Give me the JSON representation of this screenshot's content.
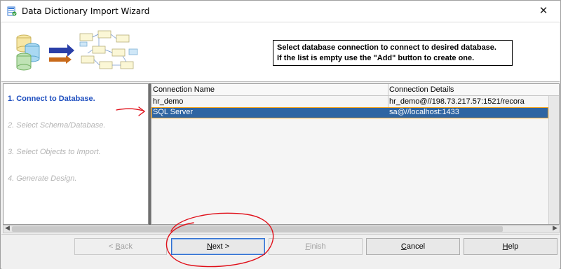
{
  "window": {
    "title": "Data Dictionary Import Wizard",
    "close_label": "✕"
  },
  "header": {
    "instruction_line1": "Select database connection to connect to desired database.",
    "instruction_line2": "If the list is empty use the \"Add\" button to create one."
  },
  "steps": [
    {
      "label": "1. Connect to Database.",
      "state": "active"
    },
    {
      "label": "2. Select Schema/Database.",
      "state": "inactive"
    },
    {
      "label": "3. Select Objects to Import.",
      "state": "inactive"
    },
    {
      "label": "4. Generate Design.",
      "state": "inactive"
    }
  ],
  "table": {
    "columns": [
      "Connection Name",
      "Connection Details"
    ],
    "rows": [
      {
        "name": "hr_demo",
        "details": "hr_demo@//198.73.217.57:1521/recora",
        "selected": false
      },
      {
        "name": "SQL Server",
        "details": "sa@//localhost:1433",
        "selected": true
      }
    ]
  },
  "buttons": {
    "back": {
      "mnemonic": "B",
      "rest": "ack",
      "prefix": "< "
    },
    "next": {
      "mnemonic": "N",
      "rest": "ext >"
    },
    "finish": {
      "mnemonic": "F",
      "rest": "inish"
    },
    "cancel": {
      "mnemonic": "C",
      "rest": "ancel"
    },
    "help": {
      "mnemonic": "H",
      "rest": "elp"
    }
  },
  "colors": {
    "active_step": "#1f4fbf",
    "selected_row": "#2f65a2",
    "annotation": "#e0101a"
  }
}
